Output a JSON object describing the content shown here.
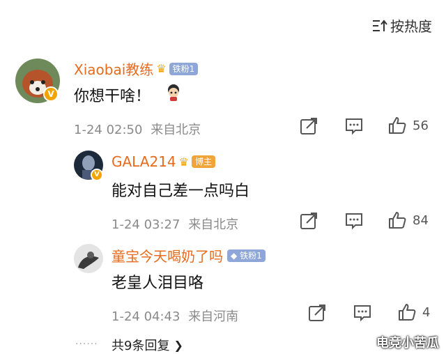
{
  "sort_label": "按热度",
  "comments": [
    {
      "username": "Xiaobai教练",
      "badge": "铁粉1",
      "text": "你想干啥！",
      "time": "1-24 02:50",
      "location": "来自北京",
      "likes": "56"
    }
  ],
  "replies": [
    {
      "username": "GALA214",
      "badge": "博主",
      "text": "能对自己差一点吗白",
      "time": "1-24 03:27",
      "location": "来自北京",
      "likes": "84"
    },
    {
      "username": "童宝今天喝奶了吗",
      "badge": "铁粉1",
      "text": "老皇人泪目咯",
      "time": "1-24 04:43",
      "location": "来自河南",
      "likes": "4"
    }
  ],
  "more_replies": "共9条回复",
  "watermark": "电竞小苦瓜",
  "colors": {
    "username": "#e86b1d",
    "badge_fan": "#8fa7d8",
    "badge_host": "#f0a43a",
    "verified": "#f2a400"
  }
}
